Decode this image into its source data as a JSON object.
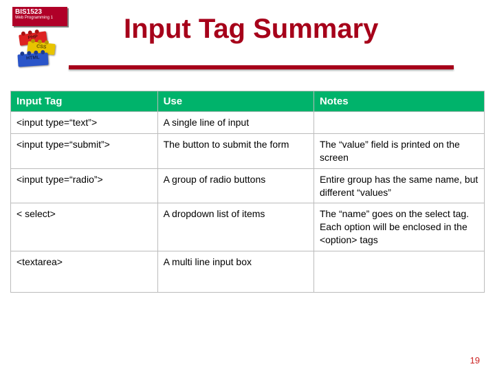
{
  "course": {
    "code": "BIS1523",
    "subtitle": "Web Programming 1"
  },
  "bricks": {
    "top": "PHP",
    "mid": "CSS",
    "bot": "HTML"
  },
  "title": "Input Tag Summary",
  "page_number": "19",
  "table": {
    "headers": [
      "Input Tag",
      "Use",
      "Notes"
    ],
    "rows": [
      {
        "tag": "<input type=“text”>",
        "use": "A single line of input",
        "notes": ""
      },
      {
        "tag": "<input type=“submit”>",
        "use": "The button to submit the form",
        "notes": "The “value” field is printed on the screen"
      },
      {
        "tag": "<input type=“radio”>",
        "use": "A group of radio buttons",
        "notes": "Entire group has the same name, but different “values”"
      },
      {
        "tag": "< select>",
        "use": "A dropdown list of items",
        "notes": "The “name” goes on the select tag.\nEach option will be enclosed in the <option> tags"
      },
      {
        "tag": "<textarea>",
        "use": "A multi line input box",
        "notes": ""
      }
    ]
  }
}
